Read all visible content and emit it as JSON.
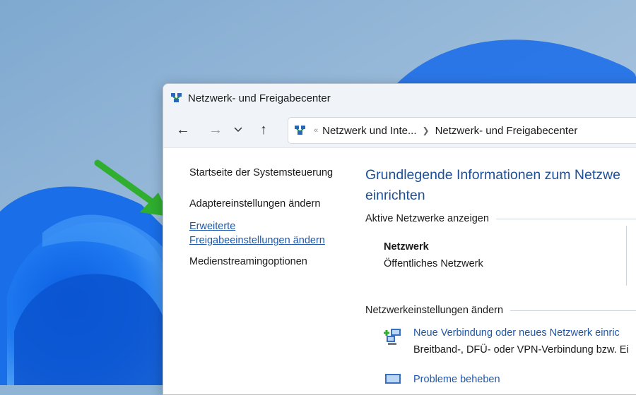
{
  "window": {
    "title": "Netzwerk- und Freigabecenter",
    "accent": "#1e4f95",
    "link_color": "#1e56a8"
  },
  "nav": {
    "back_icon": "arrow-left-icon",
    "forward_icon": "arrow-right-icon",
    "recent_icon": "chevron-down-icon",
    "up_icon": "arrow-up-icon"
  },
  "address": {
    "crumb1": "Netzwerk und Inte...",
    "crumb2": "Netzwerk- und Freigabecenter"
  },
  "sidebar": {
    "home": "Startseite der Systemsteuerung",
    "adapter": "Adaptereinstellungen ändern",
    "advanced_line1": "Erweiterte",
    "advanced_line2": "Freigabeeinstellungen ändern",
    "streaming": "Medienstreamingoptionen"
  },
  "main": {
    "heading_line1": "Grundlegende Informationen zum Netzwe",
    "heading_line2": "einrichten",
    "active_networks_label": "Aktive Netzwerke anzeigen",
    "network_name": "Netzwerk",
    "network_type": "Öffentliches Netzwerk",
    "settings_label": "Netzwerkeinstellungen ändern",
    "task1_link": "Neue Verbindung oder neues Netzwerk einric",
    "task1_desc": "Breitband-, DFÜ- oder VPN-Verbindung bzw. Ei",
    "task2_link": "Probleme beheben"
  },
  "annotation": {
    "arrow_color": "#2fae2f"
  }
}
